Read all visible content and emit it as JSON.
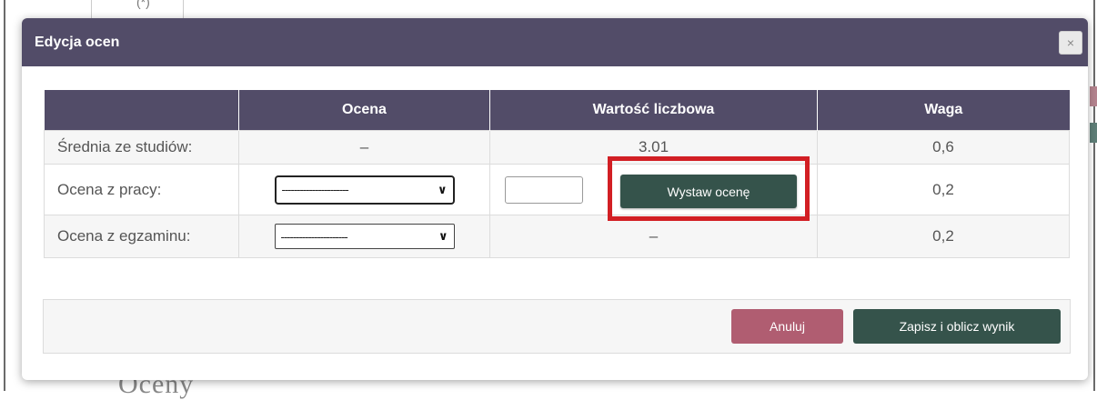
{
  "background": {
    "top_fragment": "(*)",
    "bottom_heading": "Oceny"
  },
  "dialog": {
    "title": "Edycja ocen",
    "close_symbol": "×",
    "columns": [
      "",
      "Ocena",
      "Wartość liczbowa",
      "Waga"
    ],
    "rows": [
      {
        "label": "Średnia ze studiów:",
        "grade": "–",
        "numeric_value": "3.01",
        "weight": "0,6"
      },
      {
        "label": "Ocena z pracy:",
        "grade_select": "----------------------",
        "numeric_input_value": "",
        "issue_button": "Wystaw ocenę",
        "weight": "0,2"
      },
      {
        "label": "Ocena z egzaminu:",
        "grade_select": "----------------------",
        "numeric_value": "–",
        "weight": "0,2"
      }
    ],
    "footer": {
      "cancel_label": "Anuluj",
      "save_label": "Zapisz i oblicz wynik"
    }
  },
  "colors": {
    "header_bg": "#524c68",
    "primary_button": "#35534b",
    "cancel_button": "#b05d71",
    "highlight_box": "#d21f24"
  },
  "icons": {
    "close": "close-icon",
    "select_arrow": "chevron-down-icon"
  }
}
